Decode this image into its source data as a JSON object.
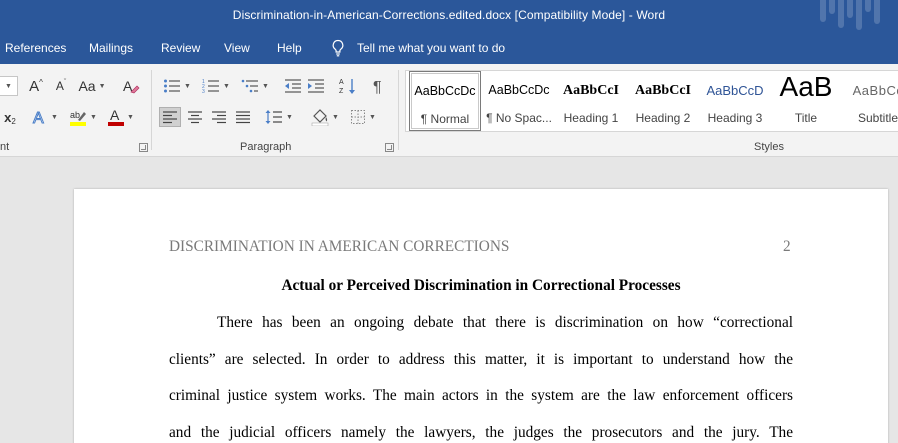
{
  "window": {
    "title": "Discrimination-in-American-Corrections.edited.docx [Compatibility Mode]  -  Word"
  },
  "menu": {
    "tabs": [
      "References",
      "Mailings",
      "Review",
      "View",
      "Help"
    ],
    "tell_me": "Tell me what you want to do",
    "tell_me_icon": "lightbulb-icon"
  },
  "ribbon": {
    "font_group_label": "nt",
    "paragraph_group_label": "Paragraph",
    "styles_group_label": "Styles",
    "font_buttons": {
      "grow_font": "A",
      "shrink_font": "A",
      "change_case": "Aa",
      "subscript": "x",
      "text_effects": "A",
      "font_color": "A"
    },
    "styles": [
      {
        "preview": "AaBbCcDc",
        "name": "¶ Normal"
      },
      {
        "preview": "AaBbCcDc",
        "name": "¶ No Spac..."
      },
      {
        "preview": "AaBbCcI",
        "name": "Heading 1"
      },
      {
        "preview": "AaBbCcI",
        "name": "Heading 2"
      },
      {
        "preview": "AaBbCcD",
        "name": "Heading 3"
      },
      {
        "preview": "AaB",
        "name": "Title"
      },
      {
        "preview": "AaBbCc",
        "name": "Subtitle"
      }
    ],
    "colors": {
      "highlight": "#ffff00",
      "font_color": "#c00000",
      "heading_blue": "#2f5496"
    }
  },
  "document": {
    "running_head": "DISCRIMINATION IN AMERICAN CORRECTIONS",
    "page_number": "2",
    "title": "Actual or Perceived Discrimination in Correctional Processes",
    "lines": [
      "There has been an ongoing debate that there is discrimination on how “correctional",
      "clients” are selected. In order to address this matter, it is important to understand how the",
      "criminal justice system works. The main actors in the system are the law enforcement officers",
      "and the judicial officers namely the lawyers, the judges the prosecutors and the jury. The"
    ]
  },
  "theme": {
    "title_bar": "#2b579a",
    "ribbon_bg": "#f3f3f3",
    "doc_bg": "#e6e6e6"
  }
}
